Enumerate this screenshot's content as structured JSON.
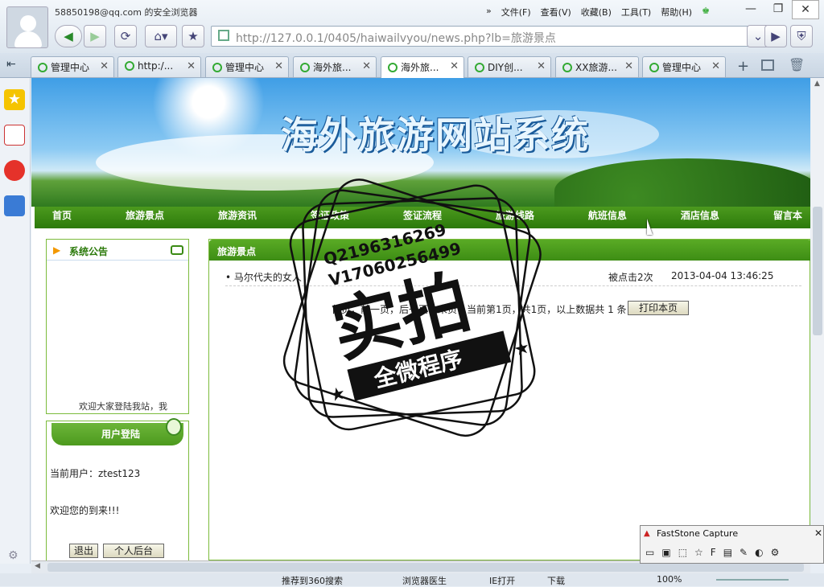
{
  "browser": {
    "title": "58850198@qq.com 的安全浏览器",
    "menus": [
      "文件(F)",
      "查看(V)",
      "收藏(B)",
      "工具(T)",
      "帮助(H)"
    ],
    "address": "http://127.0.0.1/0405/haiwailvyou/news.php?lb=旅游景点"
  },
  "tabs": [
    {
      "label": "管理中心"
    },
    {
      "label": "http:/..."
    },
    {
      "label": "管理中心"
    },
    {
      "label": "海外旅..."
    },
    {
      "label": "海外旅..."
    },
    {
      "label": "DIY创..."
    },
    {
      "label": "XX旅游..."
    },
    {
      "label": "管理中心"
    }
  ],
  "site": {
    "title": "海外旅游网站系统",
    "nav": [
      "首页",
      "旅游景点",
      "旅游资讯",
      "签证政策",
      "签证流程",
      "旅游线路",
      "航班信息",
      "酒店信息",
      "留言本"
    ]
  },
  "notice": {
    "title": "系统公告",
    "text": "欢迎大家登陆我站，我"
  },
  "login": {
    "title": "用户登陆",
    "current_user": "当前用户：ztest123",
    "welcome": "欢迎您的到来!!!",
    "logout": "退出",
    "backend": "个人后台"
  },
  "content": {
    "title": "旅游景点",
    "rows": [
      {
        "title": "• 马尔代夫的女人",
        "clicks": "被点击2次",
        "date": "2013-04-04 13:46:25"
      }
    ],
    "pager": "首页，前一页，后一页，末页，当前第1页，共1页，以上数据共 1 条，",
    "print": "打印本页"
  },
  "watermark": {
    "line1": "Q2196316269",
    "line2": "V17060256499",
    "main": "实拍",
    "sub": "全微程序"
  },
  "statusbar": {
    "items": [
      "推荐到360搜索",
      "浏览器医生",
      "IE打开",
      "下载",
      "100%"
    ]
  },
  "faststone": {
    "title": "FastStone Capture"
  }
}
